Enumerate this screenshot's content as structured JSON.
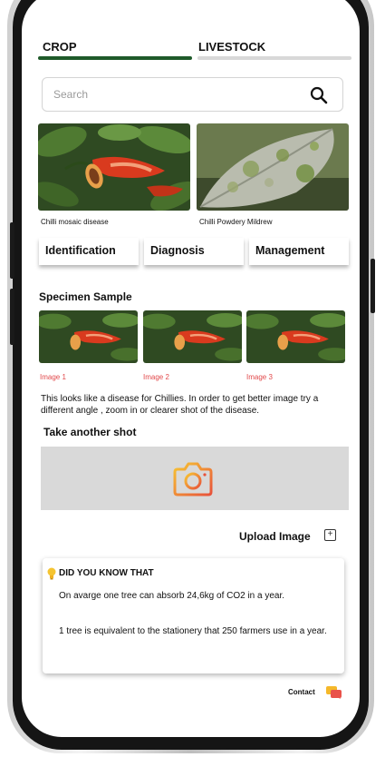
{
  "tabs": [
    {
      "label": "CROP",
      "active": true
    },
    {
      "label": "LIVESTOCK",
      "active": false
    }
  ],
  "colors": {
    "active_tab": "#1f5a2a",
    "inactive_tab": "#d8d8d8",
    "sample_label": "#e2494b",
    "camera_gradient": [
      "#f7c533",
      "#e8523a"
    ]
  },
  "search": {
    "placeholder": "Search",
    "icon": "search-icon"
  },
  "diseases": [
    {
      "caption": "Chilli mosaic disease"
    },
    {
      "caption": "Chilli Powdery Mildrew"
    }
  ],
  "actions": [
    {
      "label": "Identification"
    },
    {
      "label": "Diagnosis"
    },
    {
      "label": "Management"
    }
  ],
  "specimen": {
    "title": "Specimen Sample",
    "images": [
      {
        "label": "Image 1"
      },
      {
        "label": "Image 2"
      },
      {
        "label": "Image 3"
      }
    ]
  },
  "advice": "This  looks like  a disease for  Chillies.  In order to  get better image try a different angle , zoom in or clearer shot of the disease.",
  "retake": {
    "title": "Take another shot",
    "icon": "camera-icon"
  },
  "upload": {
    "label": "Upload Image",
    "icon": "plus-square-icon"
  },
  "fact": {
    "title": "DID YOU KNOW THAT",
    "icon": "lightbulb-icon",
    "lines": [
      "On avarge one tree can absorb 24,6kg of CO2 in a year.",
      "1 tree is equivalent to the stationery that 250 farmers use in a year."
    ]
  },
  "contact": {
    "label": "Contact",
    "icon": "chat-icon"
  }
}
